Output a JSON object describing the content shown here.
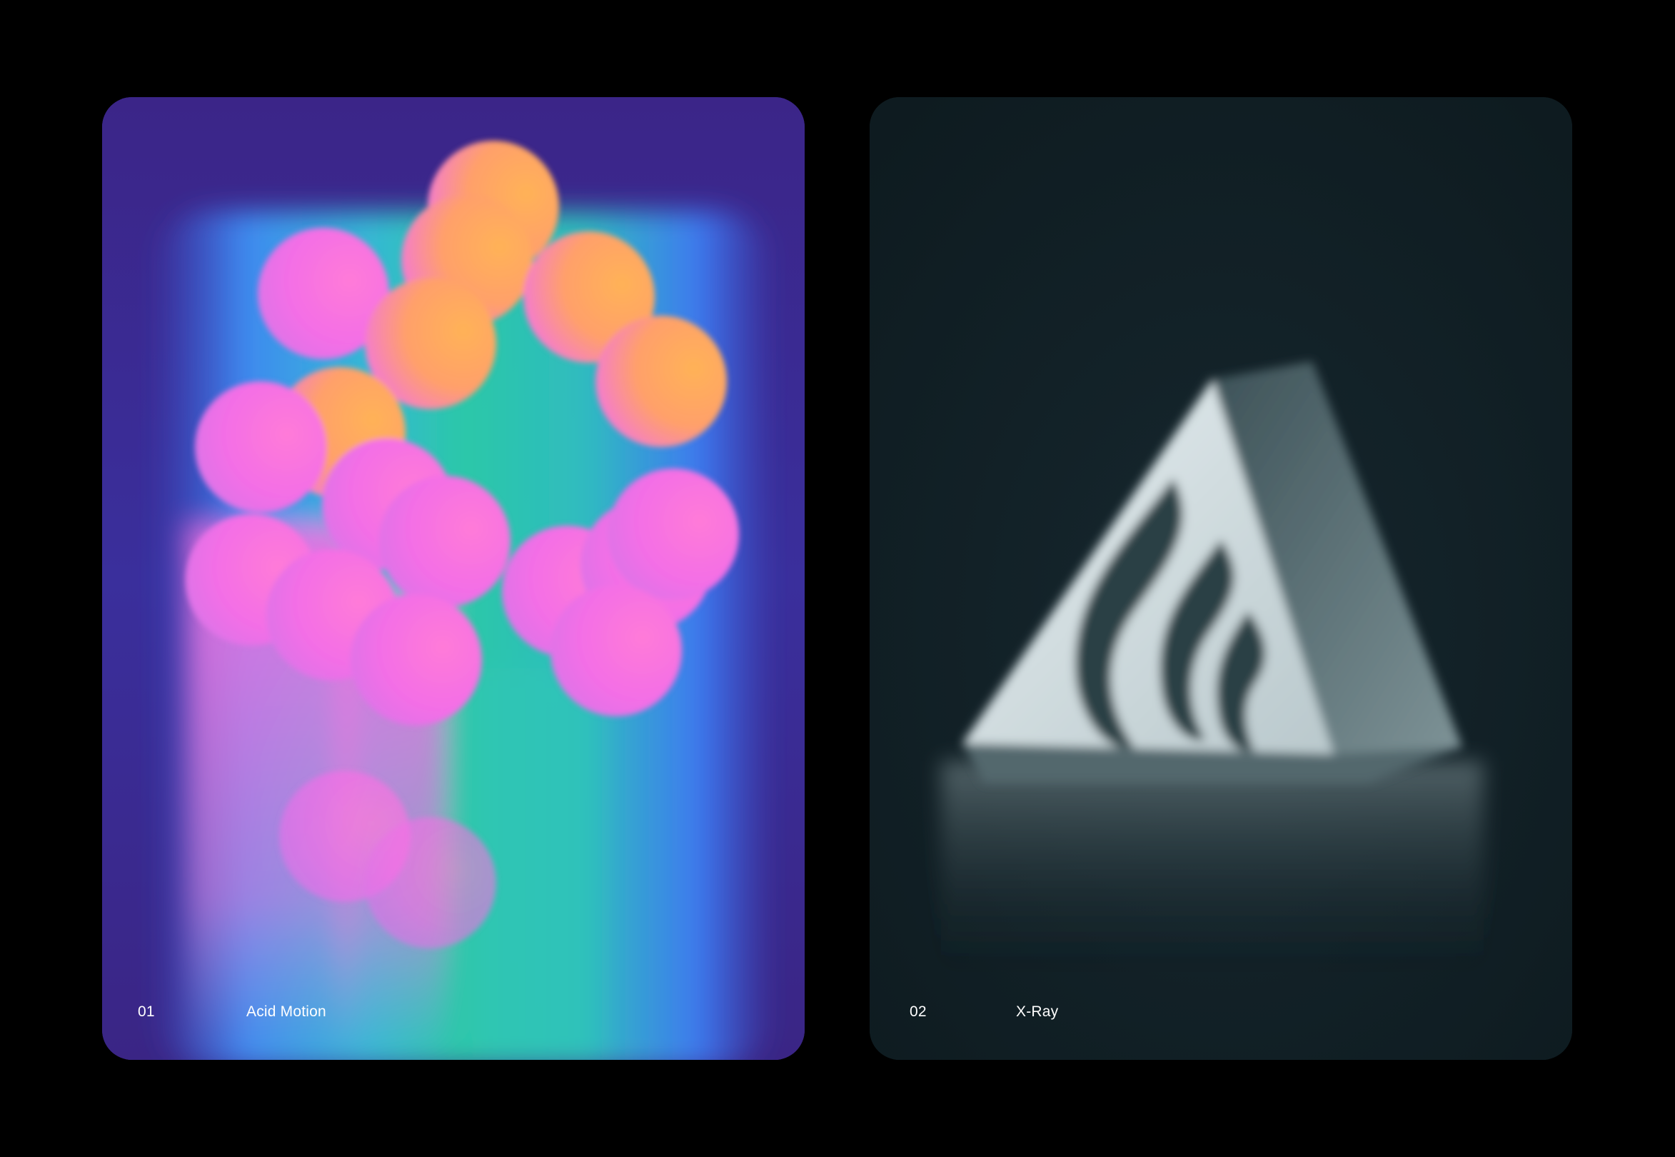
{
  "cards": [
    {
      "number": "01",
      "title": "Acid Motion",
      "accent": "#ff6fe0",
      "background": "#3d2a8f",
      "icon": "pink-spheres-artwork"
    },
    {
      "number": "02",
      "title": "X-Ray",
      "accent": "#d9e6ea",
      "background": "#112127",
      "icon": "flame-triangle-logo-artwork"
    }
  ]
}
